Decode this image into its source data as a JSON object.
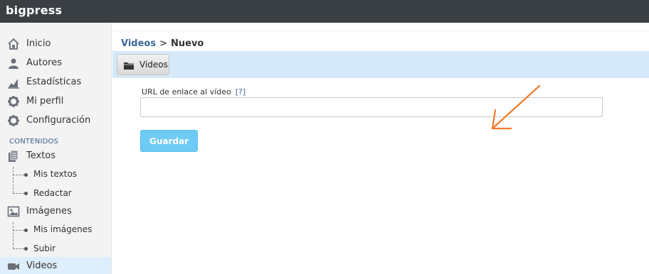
{
  "app": {
    "brand": "bigpress"
  },
  "sidebar": {
    "items": [
      {
        "label": "Inicio",
        "icon": "home-icon"
      },
      {
        "label": "Autores",
        "icon": "user-icon"
      },
      {
        "label": "Estadísticas",
        "icon": "chart-icon"
      },
      {
        "label": "Mi perfil",
        "icon": "gear-icon"
      },
      {
        "label": "Configuración",
        "icon": "gear-icon"
      }
    ],
    "section_label": "CONTENIDOS",
    "textos": {
      "label": "Textos",
      "icon": "book-icon",
      "sub": [
        "Mis textos",
        "Redactar"
      ]
    },
    "imagenes": {
      "label": "Imágenes",
      "icon": "image-icon",
      "sub": [
        "Mis imágenes",
        "Subir"
      ]
    },
    "videos": {
      "label": "Videos",
      "icon": "video-camera-icon",
      "active": true
    }
  },
  "breadcrumb": {
    "parent": "Videos",
    "separator": ">",
    "current": "Nuevo"
  },
  "tab": {
    "label": "Videos",
    "icon": "folder-icon"
  },
  "form": {
    "url_label": "URL de enlace al vídeo",
    "help_link": "[?]",
    "url_value": "",
    "url_placeholder": "",
    "save_label": "Guardar"
  },
  "colors": {
    "topbar": "#3a3f44",
    "accent": "#6ecbf5",
    "tabbar": "#d6e9fb",
    "arrow": "#f07a2c",
    "link": "#3c6a94"
  }
}
